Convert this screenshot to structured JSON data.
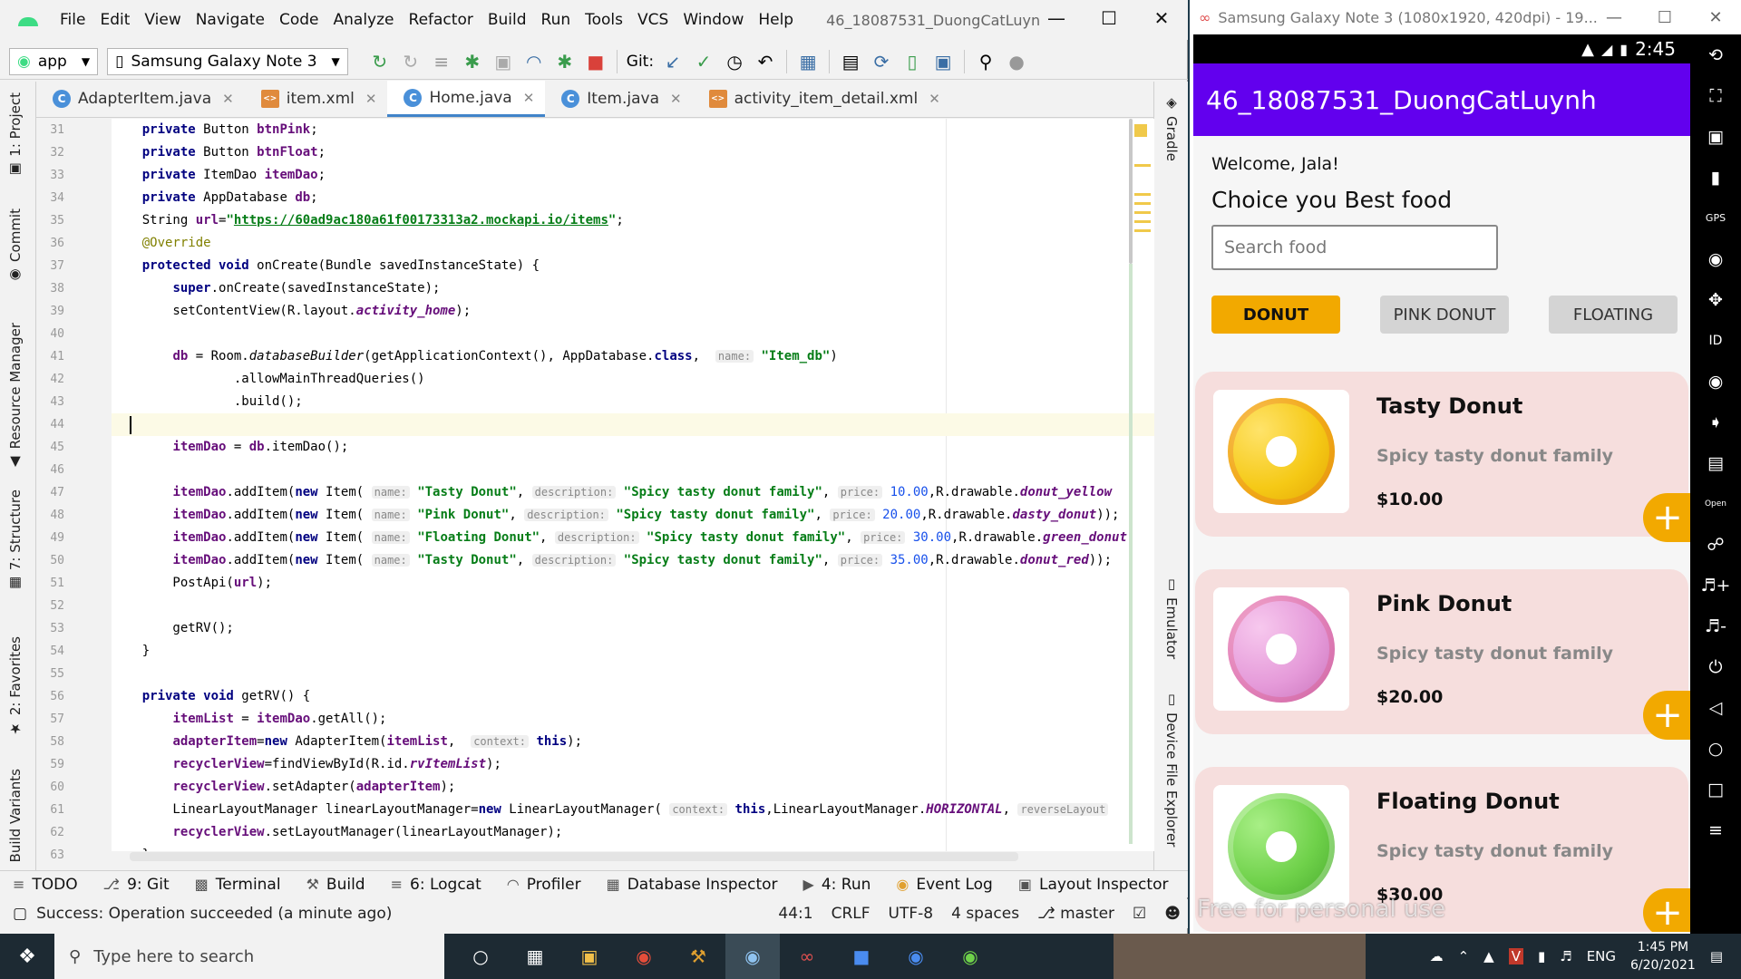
{
  "studio": {
    "menu": [
      "File",
      "Edit",
      "View",
      "Navigate",
      "Code",
      "Analyze",
      "Refactor",
      "Build",
      "Run",
      "Tools",
      "VCS",
      "Window",
      "Help"
    ],
    "window_title": "46_18087531_DuongCatLuyn",
    "toolbar": {
      "module": "app",
      "device": "Samsung Galaxy Note 3",
      "git_label": "Git:"
    },
    "tabs": [
      {
        "label": "AdapterItem.java",
        "type": "java"
      },
      {
        "label": "item.xml",
        "type": "xml"
      },
      {
        "label": "Home.java",
        "type": "java"
      },
      {
        "label": "Item.java",
        "type": "java"
      },
      {
        "label": "activity_item_detail.xml",
        "type": "xml"
      }
    ],
    "left_tool_tabs": [
      "1: Project",
      "Commit",
      "Resource Manager",
      "7: Structure",
      "2: Favorites",
      "Build Variants"
    ],
    "right_tool_tabs": [
      "Gradle",
      "Emulator",
      "Device File Explorer"
    ],
    "line_numbers": [
      "31",
      "32",
      "33",
      "34",
      "35",
      "36",
      "37",
      "38",
      "39",
      "40",
      "41",
      "42",
      "43",
      "44",
      "45",
      "46",
      "47",
      "48",
      "49",
      "50",
      "51",
      "52",
      "53",
      "54",
      "55",
      "56",
      "57",
      "58",
      "59",
      "60",
      "61",
      "62",
      "63"
    ],
    "bottom_tools": [
      "TODO",
      "9: Git",
      "Terminal",
      "Build",
      "6: Logcat",
      "Profiler",
      "Database Inspector",
      "4: Run",
      "Event Log",
      "Layout Inspector"
    ],
    "status": {
      "message": "Success: Operation succeeded (a minute ago)",
      "position": "44:1",
      "line_sep": "CRLF",
      "encoding": "UTF-8",
      "indent": "4 spaces",
      "branch": "master"
    }
  },
  "emulator": {
    "title": "Samsung Galaxy Note 3 (1080x1920, 420dpi) - 19...",
    "clock": "2:45",
    "app_title": "46_18087531_DuongCatLuynh",
    "welcome": "Welcome, Jala!",
    "heading": "Choice you Best food",
    "search_placeholder": "Search food",
    "filters": [
      "DONUT",
      "PINK DONUT",
      "FLOATING"
    ],
    "items": [
      {
        "name": "Tasty Donut",
        "description": "Spicy tasty donut family",
        "price": "$10.00",
        "color": "#f5c916"
      },
      {
        "name": "Pink Donut",
        "description": "Spicy tasty donut family",
        "price": "$20.00",
        "color": "#e59ad9"
      },
      {
        "name": "Floating Donut",
        "description": "Spicy tasty donut family",
        "price": "$30.00",
        "color": "#6fd14a"
      }
    ],
    "watermark": "Free for personal use"
  },
  "taskbar": {
    "search_placeholder": "Type here to search",
    "language": "ENG",
    "time": "1:45 PM",
    "date": "6/20/2021"
  },
  "colors": {
    "accent_purple": "#6200ee",
    "accent_yellow": "#f2a900",
    "card_bg": "#f6dedd"
  }
}
